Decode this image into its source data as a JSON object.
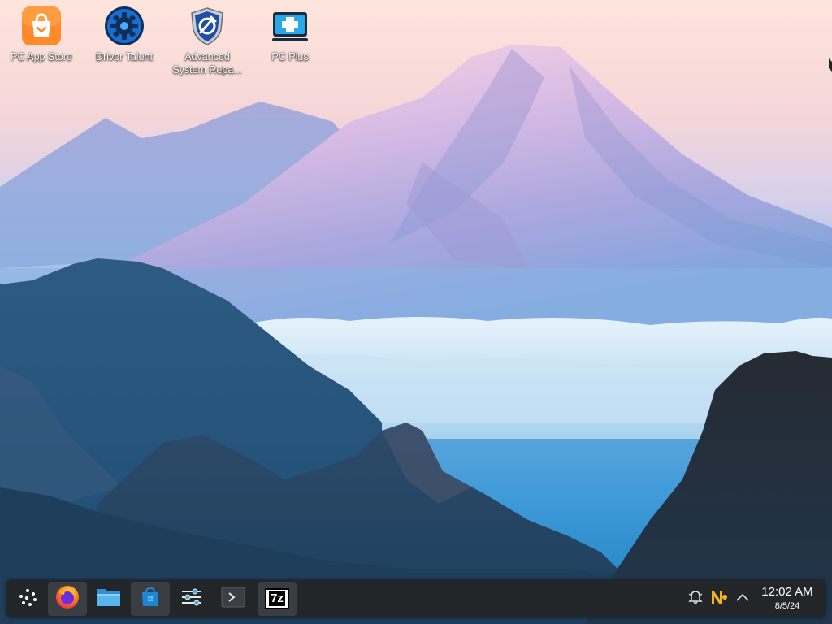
{
  "desktop": {
    "icons": [
      {
        "label": "PC App Store",
        "icon": "shopping-bag-icon"
      },
      {
        "label": "Driver Talent",
        "icon": "gear-icon"
      },
      {
        "label": "Advanced System Repa...",
        "icon": "shield-wrench-icon"
      },
      {
        "label": "PC Plus",
        "icon": "monitor-plus-icon"
      }
    ]
  },
  "taskbar": {
    "launchers": [
      {
        "name": "application-launcher",
        "icon": "launcher-dots-icon"
      },
      {
        "name": "firefox",
        "icon": "firefox-icon"
      },
      {
        "name": "file-manager",
        "icon": "folder-icon"
      },
      {
        "name": "discover-store",
        "icon": "store-bag-icon"
      },
      {
        "name": "system-settings",
        "icon": "sliders-icon"
      },
      {
        "name": "terminal",
        "icon": "terminal-icon"
      },
      {
        "name": "7zip",
        "icon": "7z-icon",
        "text": "7z"
      }
    ],
    "tray": {
      "items": [
        {
          "name": "notifications",
          "icon": "bell-icon"
        },
        {
          "name": "app-updates",
          "icon": "n-plus-icon"
        },
        {
          "name": "show-hidden",
          "icon": "chevron-up-icon"
        }
      ]
    },
    "clock": {
      "time": "12:02 AM",
      "date": "8/5/24"
    }
  },
  "colors": {
    "panel": "#232629",
    "panel_active": "#3a3e43",
    "text": "#fcfcfc",
    "accent": "#3daee9"
  }
}
